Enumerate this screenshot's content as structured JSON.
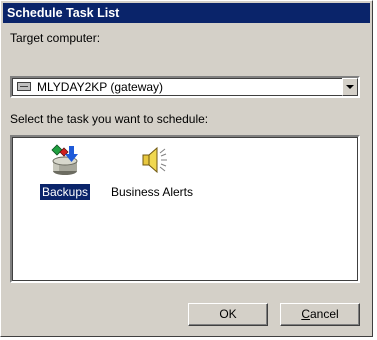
{
  "window": {
    "title": "Schedule Task List"
  },
  "target": {
    "label": "Target computer:",
    "selected": "MLYDAY2KP (gateway)",
    "icon": "computer-icon"
  },
  "tasks": {
    "label": "Select the task you want to schedule:",
    "items": [
      {
        "label": "Backups",
        "icon": "backup-icon",
        "selected": true
      },
      {
        "label": "Business Alerts",
        "icon": "speaker-alert-icon",
        "selected": false
      }
    ]
  },
  "buttons": {
    "ok": "OK",
    "cancel": "Cancel"
  },
  "colors": {
    "titlebar": "#0a246a",
    "face": "#d4d0c8",
    "selection": "#0a246a"
  }
}
